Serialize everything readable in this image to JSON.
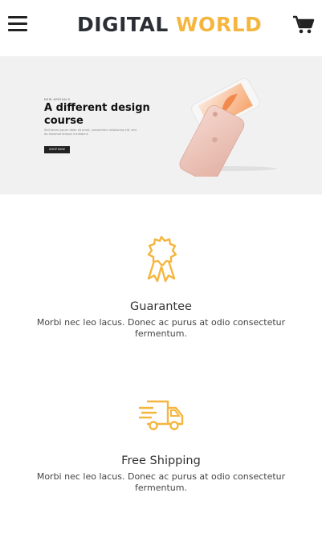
{
  "header": {
    "logo_part1": "DIGITAL ",
    "logo_part2": "WORLD",
    "menu_icon": "hamburger-menu-icon",
    "cart_icon": "shopping-cart-icon"
  },
  "banner": {
    "kicker": "NEW ARRIVALS",
    "headline": "A different design course",
    "description": "Sed lorem ipsum dolor sit amet, consectetur adipiscing elit, sed do eiusmod tempor incididunt.",
    "button_label": "SHOP NOW",
    "image": "iphone-product-image"
  },
  "features": [
    {
      "icon": "award-ribbon-icon",
      "title": "Guarantee",
      "text": "Morbi nec leo lacus. Donec ac purus at odio consectetur fermentum."
    },
    {
      "icon": "delivery-truck-icon",
      "title": "Free Shipping",
      "text": "Morbi nec leo lacus. Donec ac purus at odio consectetur fermentum."
    }
  ],
  "colors": {
    "accent": "#f4b63f",
    "logo_dark": "#2a2f36",
    "banner_bg": "#f1f1f1"
  }
}
